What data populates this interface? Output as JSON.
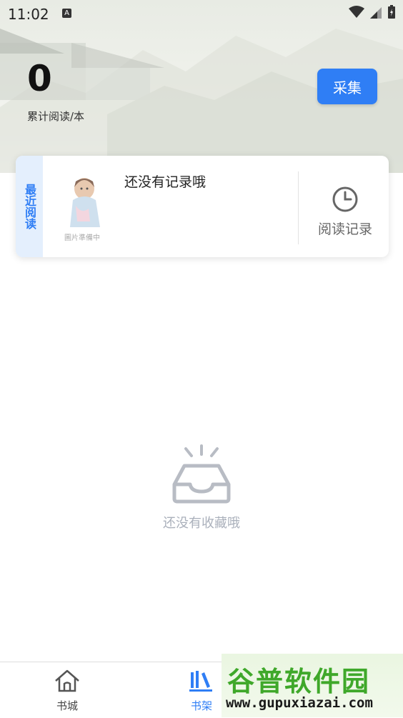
{
  "status_bar": {
    "time": "11:02",
    "notification_badge": "A"
  },
  "header": {
    "read_count": "0",
    "read_count_label": "累计阅读/本",
    "collect_button": "采集"
  },
  "recent": {
    "tab_label": "最近阅读",
    "cover_caption": "圖片準備中",
    "empty_message": "还没有记录哦",
    "history_label": "阅读记录"
  },
  "shelf": {
    "empty_message": "还没有收藏哦"
  },
  "bottom_nav": {
    "items": [
      {
        "label": "书城",
        "icon": "home-icon",
        "active": false
      },
      {
        "label": "书架",
        "icon": "bookshelf-icon",
        "active": true
      }
    ]
  },
  "watermark": {
    "title": "谷普软件园",
    "url": "www.gupuxiazai.com"
  },
  "colors": {
    "accent": "#2f7ef5",
    "tab_bg": "#e4effd",
    "watermark_green": "#3fa82a"
  }
}
